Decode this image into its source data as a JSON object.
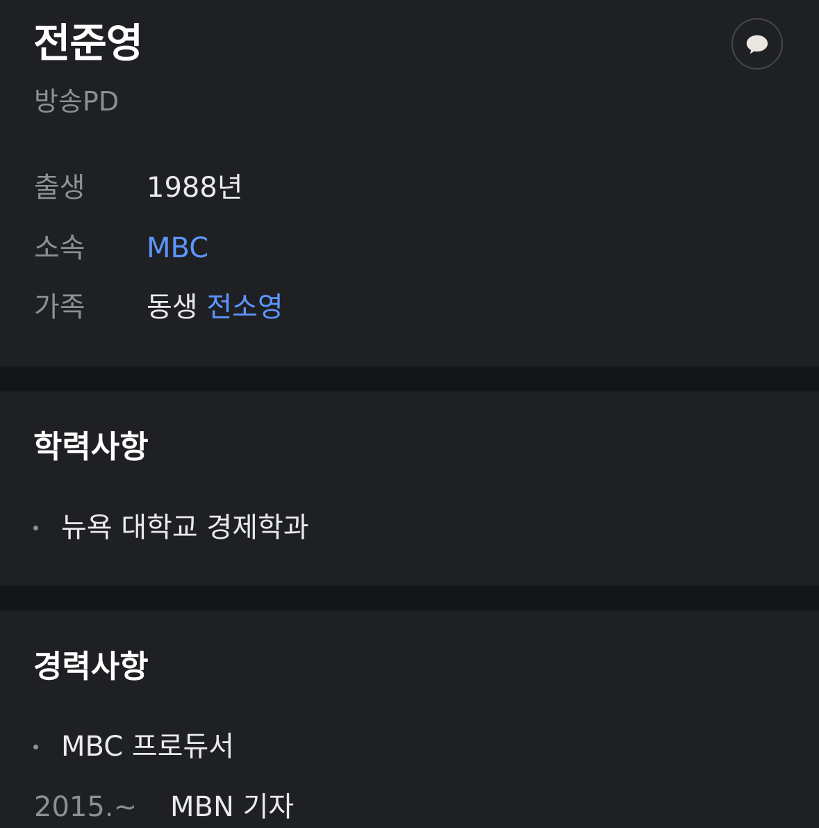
{
  "profile": {
    "name": "전준영",
    "occupation": "방송PD",
    "comment_icon": "speech-bubble-icon",
    "info": {
      "birth": {
        "label": "출생",
        "value": "1988년"
      },
      "affiliation": {
        "label": "소속",
        "value": "MBC"
      },
      "family": {
        "label": "가족",
        "relation": "동생",
        "name": "전소영"
      }
    }
  },
  "education": {
    "title": "학력사항",
    "items": [
      "뉴욕 대학교 경제학과"
    ]
  },
  "career": {
    "title": "경력사항",
    "current": "MBC 프로듀서",
    "history": [
      {
        "year": "2015.~",
        "role": "MBN 기자"
      }
    ]
  },
  "colors": {
    "background": "#1f2024",
    "divider": "#141517",
    "link": "#5d96ff",
    "muted_text": "#8d8f96",
    "primary_text": "#ffffff"
  }
}
